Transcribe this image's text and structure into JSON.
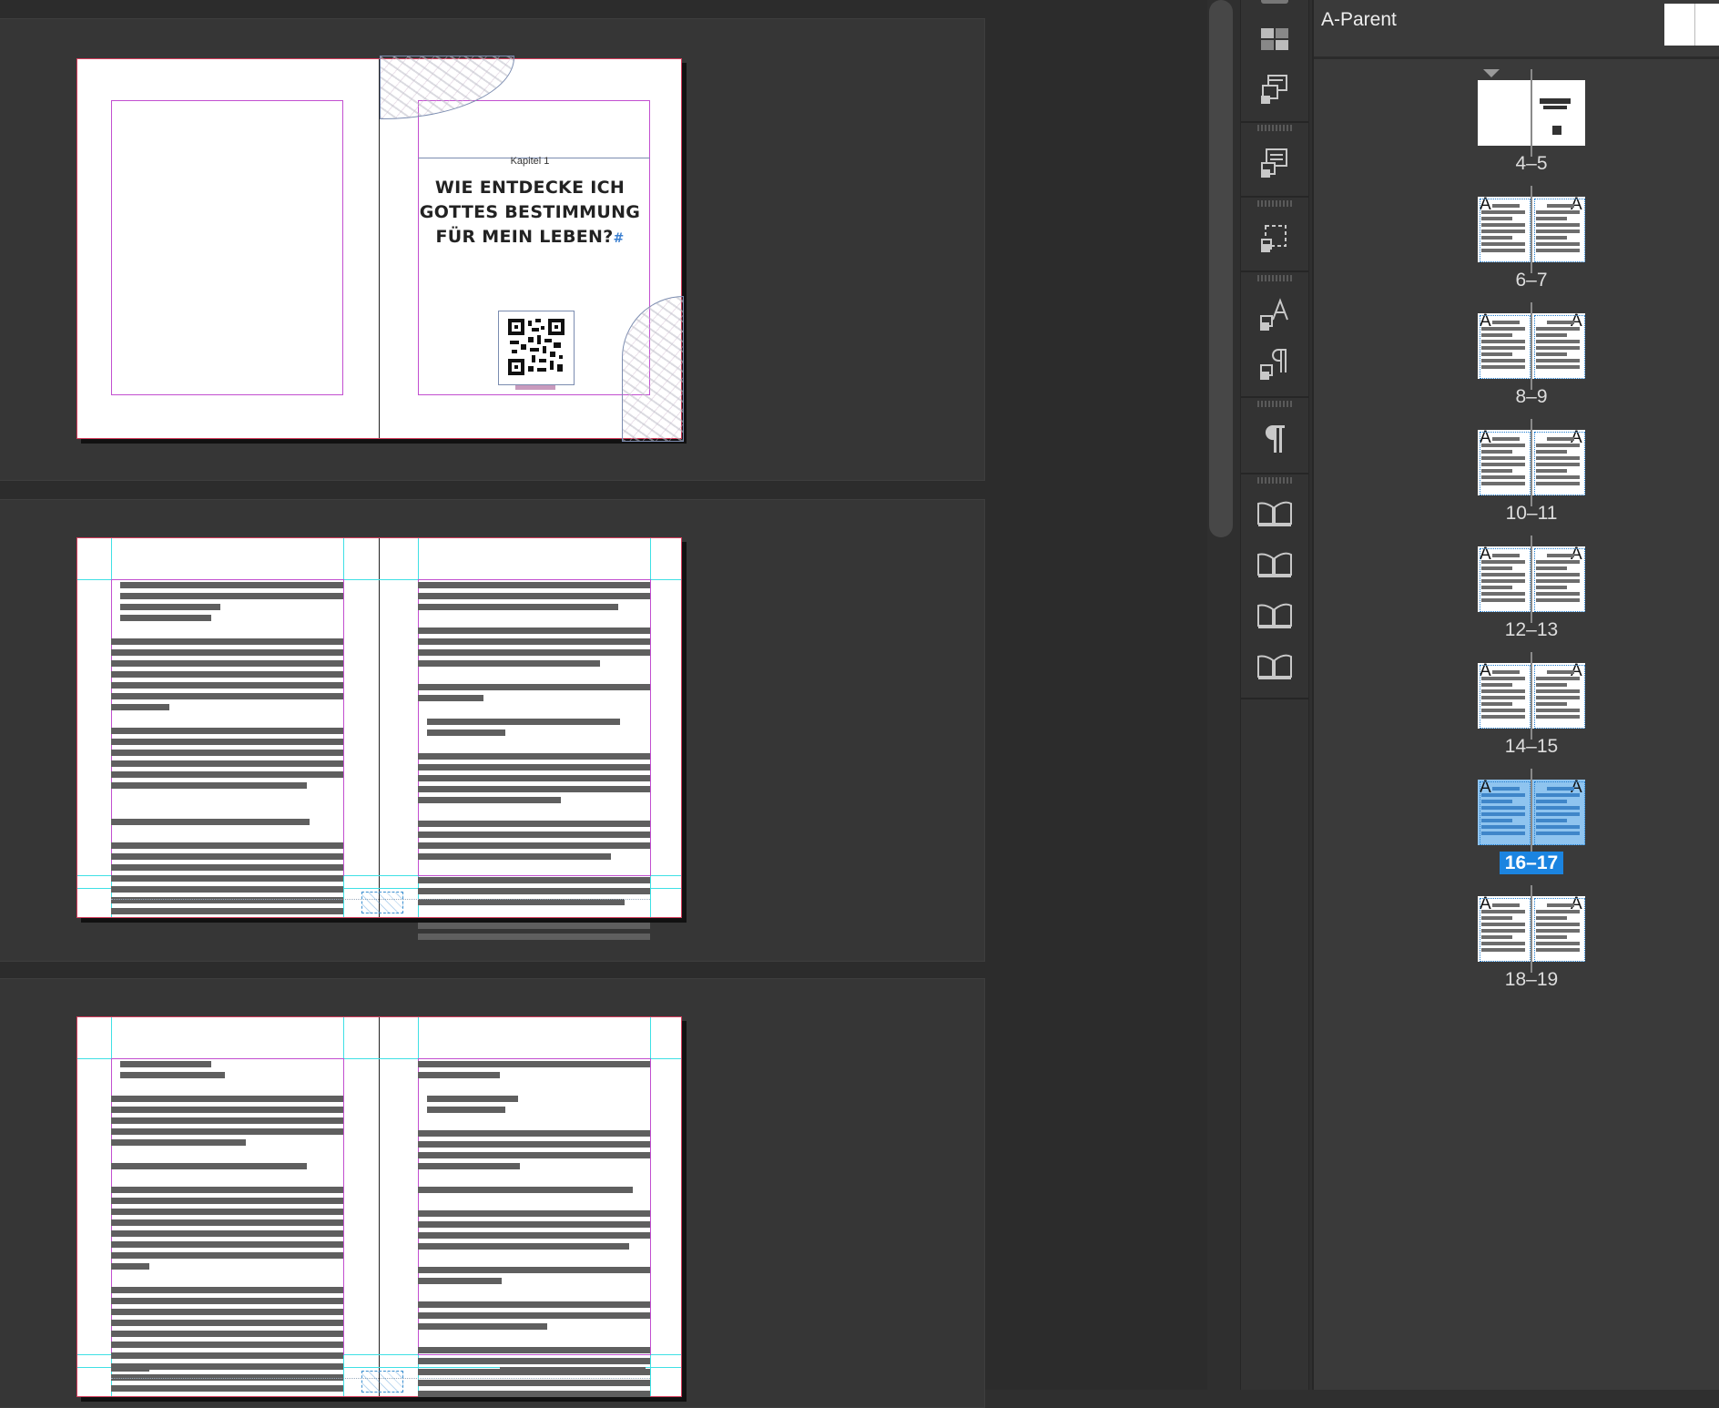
{
  "canvas": {
    "spread1": {
      "chapter_label": "Kapitel 1",
      "title_lines": [
        "WIE ENTDECKE ICH",
        "GOTTES BESTIMMUNG",
        "FÜR MEIN LEBEN?"
      ],
      "title_marker": "#"
    }
  },
  "toolbar": {
    "icons": [
      "layers-grid-icon",
      "parent-items-icon",
      "object-styles-icon",
      "frame-fitting-icon",
      "character-styles-icon",
      "paragraph-styles-icon",
      "paragraph-icon",
      "book-icon",
      "book-icon",
      "book-icon",
      "book-icon"
    ]
  },
  "pages_panel": {
    "parent_label": "A-Parent",
    "spreads": [
      {
        "label": "4–5",
        "prefix_left": "",
        "prefix_right": "",
        "selected": false
      },
      {
        "label": "6–7",
        "prefix_left": "A",
        "prefix_right": "A",
        "selected": false
      },
      {
        "label": "8–9",
        "prefix_left": "A",
        "prefix_right": "A",
        "selected": false
      },
      {
        "label": "10–11",
        "prefix_left": "A",
        "prefix_right": "A",
        "selected": false
      },
      {
        "label": "12–13",
        "prefix_left": "A",
        "prefix_right": "A",
        "selected": false
      },
      {
        "label": "14–15",
        "prefix_left": "A",
        "prefix_right": "A",
        "selected": false
      },
      {
        "label": "16–17",
        "prefix_left": "A",
        "prefix_right": "A",
        "selected": true
      },
      {
        "label": "18–19",
        "prefix_left": "A",
        "prefix_right": "A",
        "selected": false
      }
    ]
  },
  "colors": {
    "selection": "#1b84e0",
    "margin_guide": "#c24fd0",
    "column_guide": "#3fe0e5",
    "bleed": "#d33c5b"
  }
}
